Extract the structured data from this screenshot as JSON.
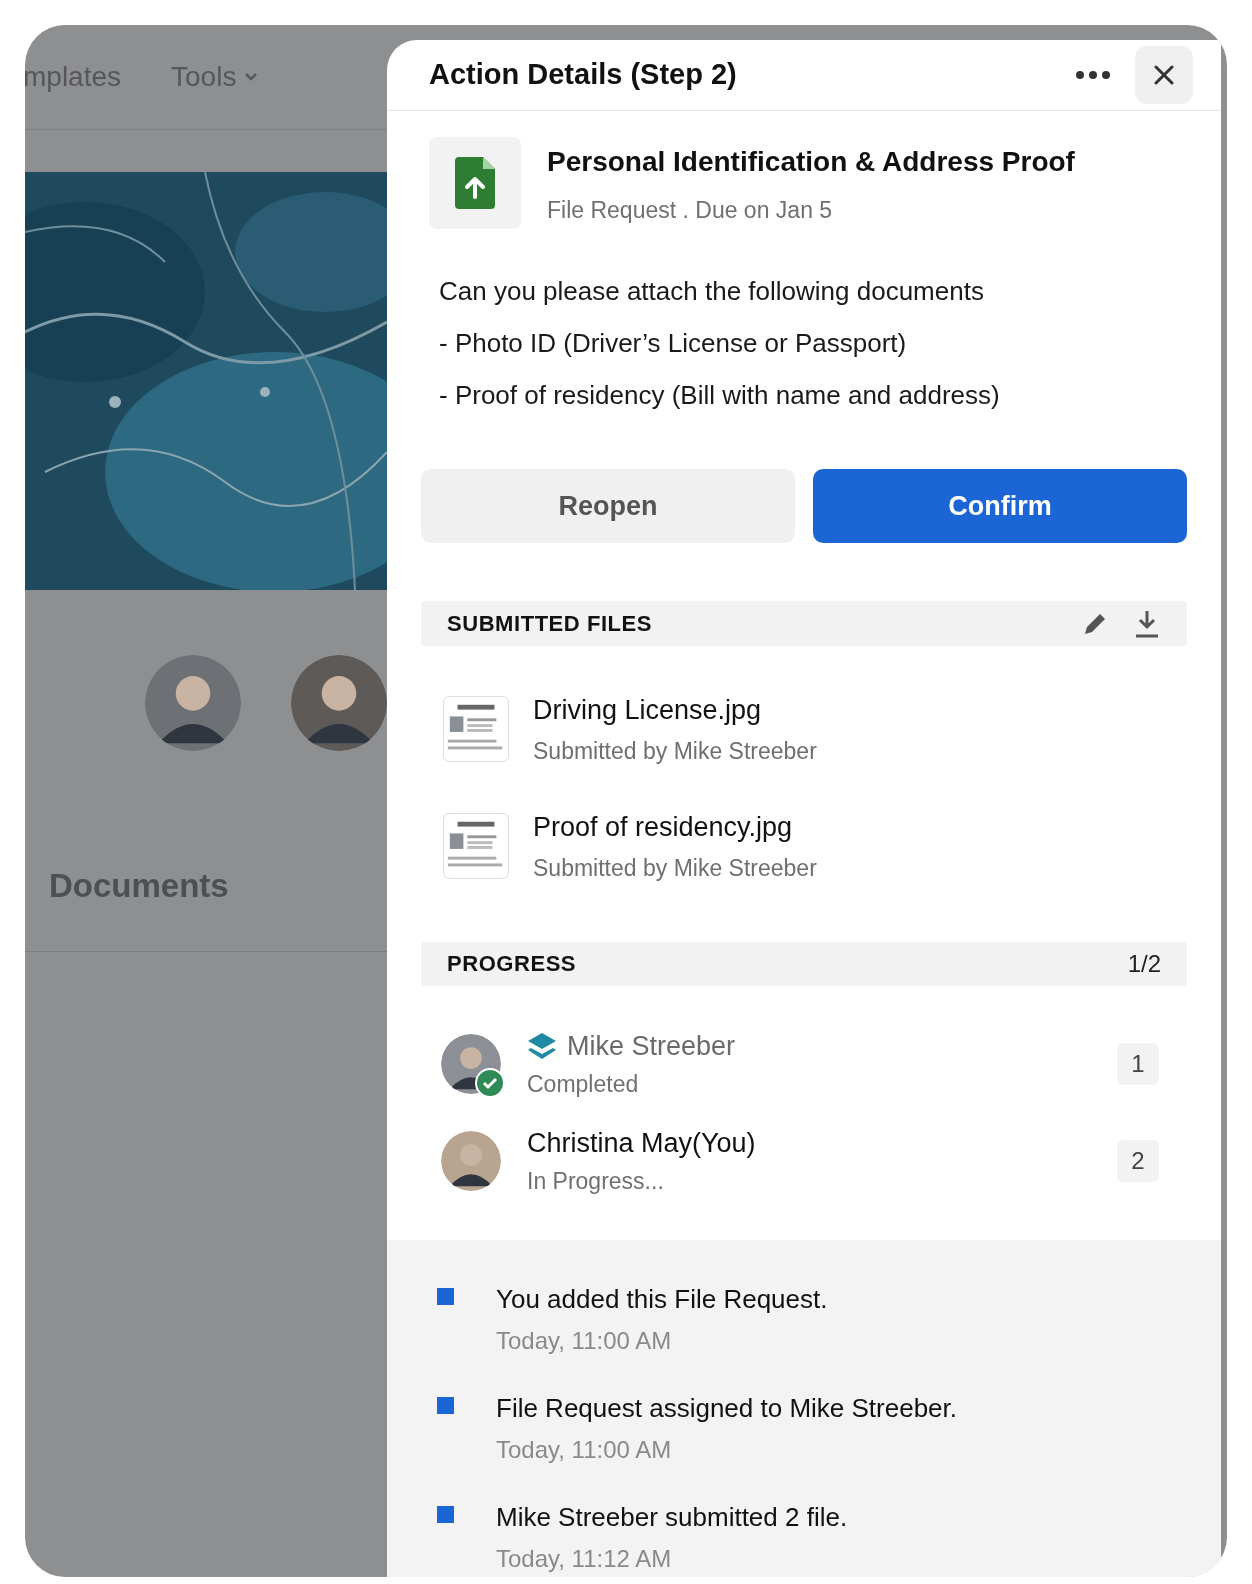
{
  "background": {
    "nav": [
      {
        "label": "mplates",
        "dropdown": false
      },
      {
        "label": "Tools",
        "dropdown": true
      }
    ],
    "section_title": "Documents"
  },
  "panel": {
    "title": "Action Details (Step 2)",
    "request": {
      "title": "Personal Identification & Address Proof",
      "subtitle": "File Request . Due on Jan 5"
    },
    "description": [
      "Can you please attach the following documents",
      "- Photo ID (Driver’s License or Passport)",
      "- Proof of residency (Bill with name and address)"
    ],
    "buttons": [
      {
        "label": "Reopen",
        "kind": "secondary"
      },
      {
        "label": "Confirm",
        "kind": "primary"
      }
    ],
    "submitted_files": {
      "title": "SUBMITTED FILES",
      "files": [
        {
          "name": "Driving License.jpg",
          "submitted_by": "Submitted by Mike Streeber"
        },
        {
          "name": "Proof of residency.jpg",
          "submitted_by": "Submitted by Mike Streeber"
        }
      ]
    },
    "progress": {
      "title": "PROGRESS",
      "count": "1/2",
      "participants": [
        {
          "name": "Mike Streeber",
          "status": "Completed",
          "step": "1",
          "completed": true
        },
        {
          "name": "Christina May(You)",
          "status": "In Progress...",
          "step": "2",
          "completed": false
        }
      ]
    },
    "activity": [
      {
        "text": "You added this File Request.",
        "time": "Today, 11:00 AM"
      },
      {
        "text": "File Request assigned to Mike Streeber.",
        "time": "Today, 11:00 AM"
      },
      {
        "text": "Mike Streeber submitted 2 file.",
        "time": "Today, 11:12 AM"
      }
    ]
  }
}
